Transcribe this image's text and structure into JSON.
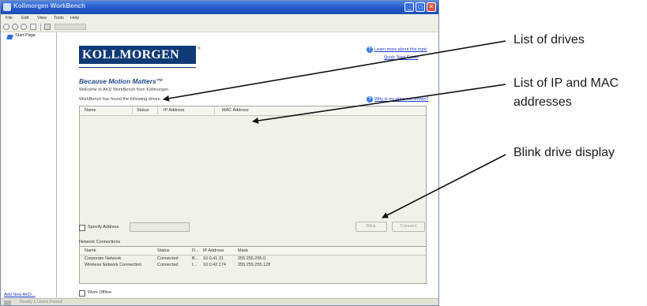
{
  "window": {
    "title": "Kollmorgen WorkBench",
    "controls": [
      "_",
      "□",
      "✕"
    ]
  },
  "menu": [
    "File",
    "Edit",
    "View",
    "Tools",
    "Help"
  ],
  "toolbar": {
    "field_value": "..."
  },
  "sidebar": {
    "items": [
      {
        "label": "Start Page"
      }
    ],
    "add_link": "Add New AKD..."
  },
  "status_bar": {
    "text": "Ready  1 Users Found"
  },
  "main": {
    "logo": "KOLLMORGEN",
    "logo_mark": "®",
    "tagline": "Because Motion Matters™",
    "welcome": "Welcome to AKD WorkBench from Kollmorgen",
    "found_text": "WorkBench has found the following drives.",
    "learn_more": "Learn more about this topic",
    "quick_start": "Quick Start Guide",
    "why_link": "Why is my drive not shown?",
    "drive_list": {
      "columns": [
        "Name",
        "Status",
        "IP Address",
        "MAC Address"
      ],
      "rows": []
    },
    "specify_address": {
      "label": "Specify Address",
      "checked": false,
      "value": ""
    },
    "buttons": {
      "blink": "Blink",
      "connect": "Connect"
    },
    "network": {
      "title": "Network Connections",
      "columns": [
        "Name",
        "Status",
        "D...",
        "IP Address",
        "Mask"
      ],
      "rows": [
        [
          "Corporate Network",
          "Connected",
          "B...",
          "10.0.41.31",
          "255.255.255.0"
        ],
        [
          "Wireless Network Connection",
          "Connected",
          "I...",
          "10.0.42.174",
          "255.255.255.128"
        ]
      ]
    },
    "work_offline": {
      "label": "Work Offline",
      "checked": false
    }
  },
  "annotations": {
    "list_of_drives": "List of drives",
    "ip_mac_line1": "List of IP and MAC",
    "ip_mac_line2": "addresses",
    "blink_display": "Blink drive display"
  },
  "colors": {
    "titlebar": "#2356c8",
    "logo_bg": "#0e3a75",
    "tagline": "#1e4a8a",
    "link": "#1a3ad0"
  }
}
